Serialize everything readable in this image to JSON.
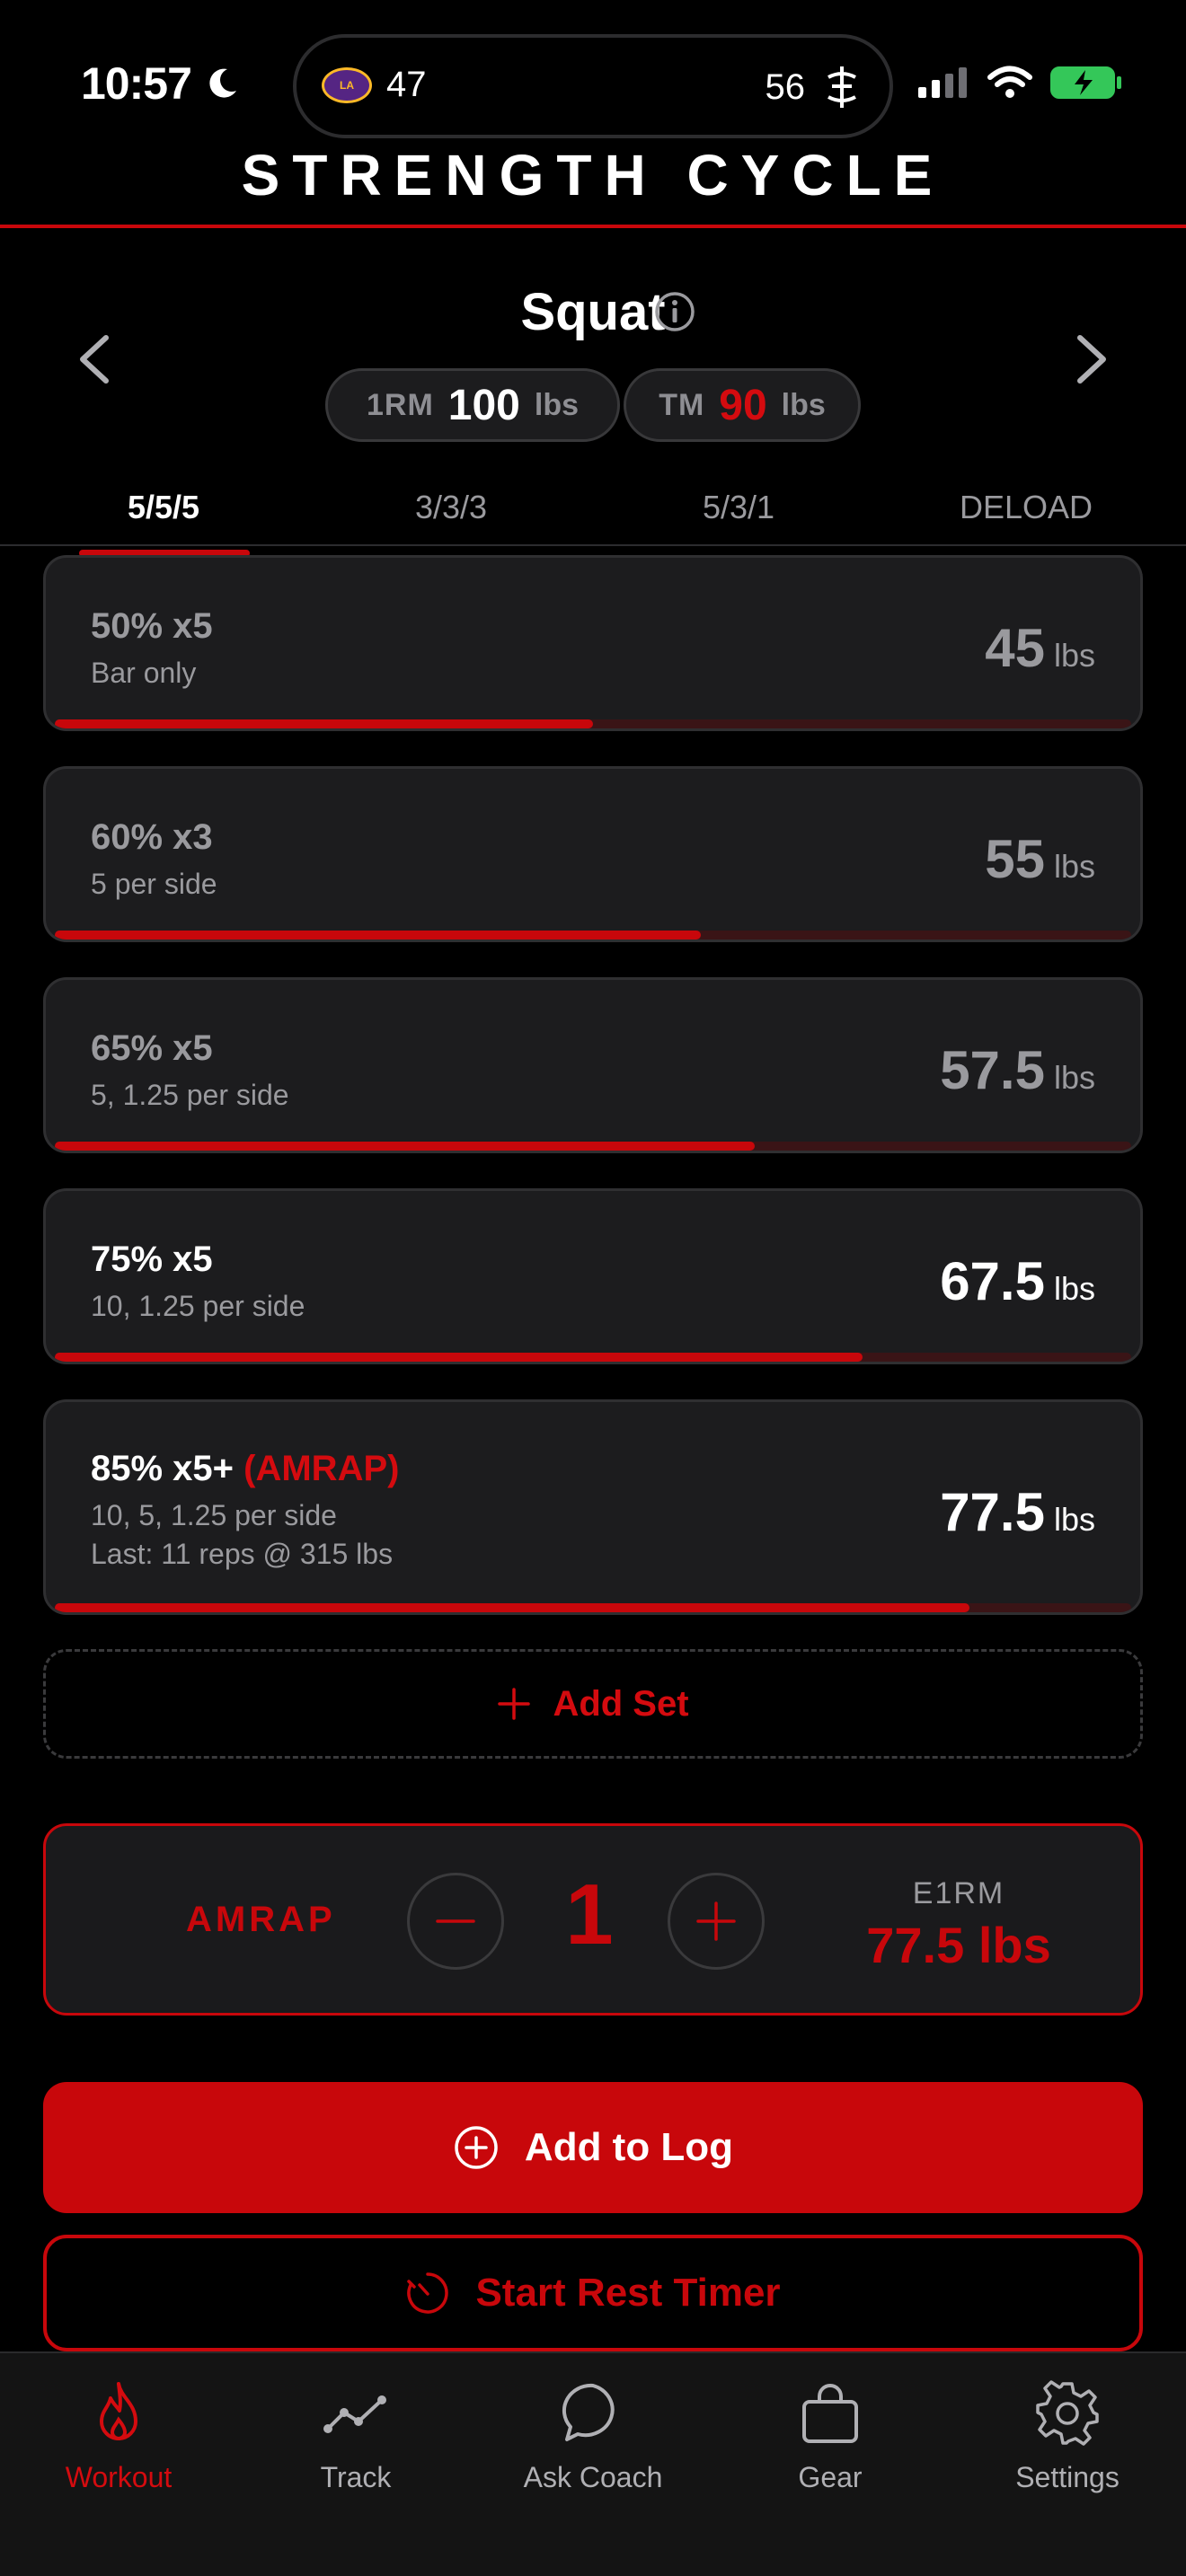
{
  "status_bar": {
    "time": "10:57",
    "live_activity": {
      "left_score": "47",
      "right_score": "56"
    }
  },
  "app": {
    "title": "STRENGTH CYCLE"
  },
  "lift": {
    "name": "Squat",
    "one_rm_label": "1RM",
    "one_rm_value": "100",
    "one_rm_unit": "lbs",
    "tm_label": "TM",
    "tm_value": "90",
    "tm_unit": "lbs"
  },
  "tabs": [
    {
      "label": "5/5/5",
      "active": true
    },
    {
      "label": "3/3/3",
      "active": false
    },
    {
      "label": "5/3/1",
      "active": false
    },
    {
      "label": "DELOAD",
      "active": false
    }
  ],
  "sets": [
    {
      "title": "50% x5",
      "plates": "Bar only",
      "weight": "45",
      "unit": "lbs",
      "progress": 0.5,
      "completed": true
    },
    {
      "title": "60% x3",
      "plates": "5 per side",
      "weight": "55",
      "unit": "lbs",
      "progress": 0.6,
      "completed": true
    },
    {
      "title": "65% x5",
      "plates": "5, 1.25 per side",
      "weight": "57.5",
      "unit": "lbs",
      "progress": 0.65,
      "completed": true
    },
    {
      "title": "75% x5",
      "plates": "10, 1.25 per side",
      "weight": "67.5",
      "unit": "lbs",
      "progress": 0.75,
      "completed": false
    },
    {
      "title": "85% x5+",
      "tag": "(AMRAP)",
      "plates": "10, 5, 1.25 per side",
      "last": "Last: 11 reps @ 315 lbs",
      "weight": "77.5",
      "unit": "lbs",
      "progress": 0.85,
      "completed": false
    }
  ],
  "add_set_label": "Add Set",
  "amrap": {
    "label": "AMRAP",
    "reps": "1",
    "e1rm_label": "E1RM",
    "e1rm_value": "77.5 lbs"
  },
  "actions": {
    "add_to_log": "Add to Log",
    "start_rest_timer": "Start Rest Timer"
  },
  "bottom_nav": [
    {
      "label": "Workout",
      "icon": "flame-icon",
      "active": true
    },
    {
      "label": "Track",
      "icon": "chart-line-icon",
      "active": false
    },
    {
      "label": "Ask Coach",
      "icon": "chat-bubble-icon",
      "active": false
    },
    {
      "label": "Gear",
      "icon": "bag-icon",
      "active": false
    },
    {
      "label": "Settings",
      "icon": "gear-icon",
      "active": false
    }
  ],
  "colors": {
    "accent": "#c8070b",
    "background": "#000000",
    "card": "#1c1c1e"
  }
}
